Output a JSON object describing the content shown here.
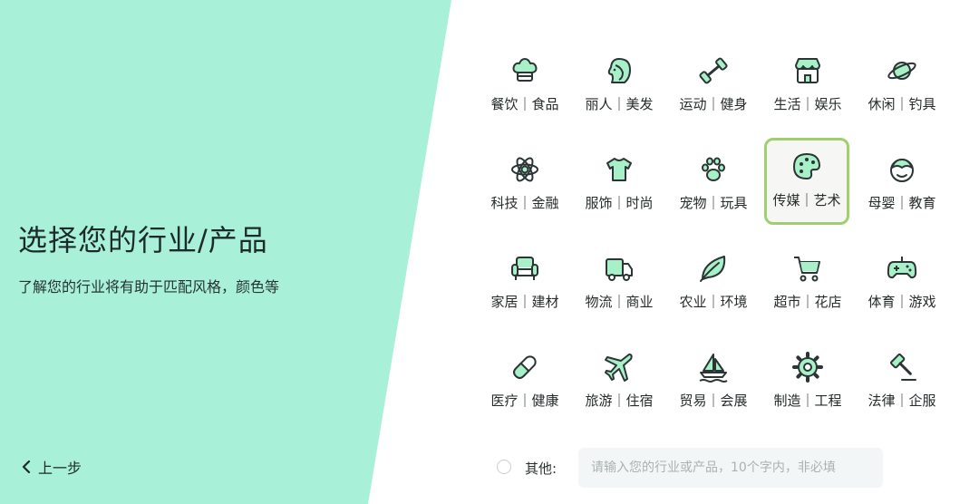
{
  "left": {
    "title": "选择您的行业/产品",
    "subtitle": "了解您的行业将有助于匹配风格，颜色等",
    "back_label": "上一步"
  },
  "industries": [
    {
      "label": "餐饮｜食品",
      "icon": "chef-hat-icon"
    },
    {
      "label": "丽人｜美发",
      "icon": "woman-hair-icon"
    },
    {
      "label": "运动｜健身",
      "icon": "dumbbell-icon"
    },
    {
      "label": "生活｜娱乐",
      "icon": "storefront-icon"
    },
    {
      "label": "休闲｜钓具",
      "icon": "planet-icon"
    },
    {
      "label": "科技｜金融",
      "icon": "atom-icon"
    },
    {
      "label": "服饰｜时尚",
      "icon": "tshirt-icon"
    },
    {
      "label": "宠物｜玩具",
      "icon": "paw-icon"
    },
    {
      "label": "传媒｜艺术",
      "icon": "palette-icon",
      "selected": true
    },
    {
      "label": "母婴｜教育",
      "icon": "baby-face-icon"
    },
    {
      "label": "家居｜建材",
      "icon": "armchair-icon"
    },
    {
      "label": "物流｜商业",
      "icon": "truck-icon"
    },
    {
      "label": "农业｜环境",
      "icon": "leaf-icon"
    },
    {
      "label": "超市｜花店",
      "icon": "shopping-cart-icon"
    },
    {
      "label": "体育｜游戏",
      "icon": "gamepad-icon"
    },
    {
      "label": "医疗｜健康",
      "icon": "pill-icon"
    },
    {
      "label": "旅游｜住宿",
      "icon": "airplane-icon"
    },
    {
      "label": "贸易｜会展",
      "icon": "sailboat-icon"
    },
    {
      "label": "制造｜工程",
      "icon": "gear-icon"
    },
    {
      "label": "法律｜企服",
      "icon": "gavel-icon"
    }
  ],
  "other": {
    "label": "其他:",
    "placeholder": "请输入您的行业或产品，10个字内，非必填"
  },
  "colors": {
    "accent_mint": "#a8f0d8",
    "icon_fill": "#a8f0c8",
    "selected_border": "#9fcf6f",
    "stroke": "#2b3535"
  }
}
